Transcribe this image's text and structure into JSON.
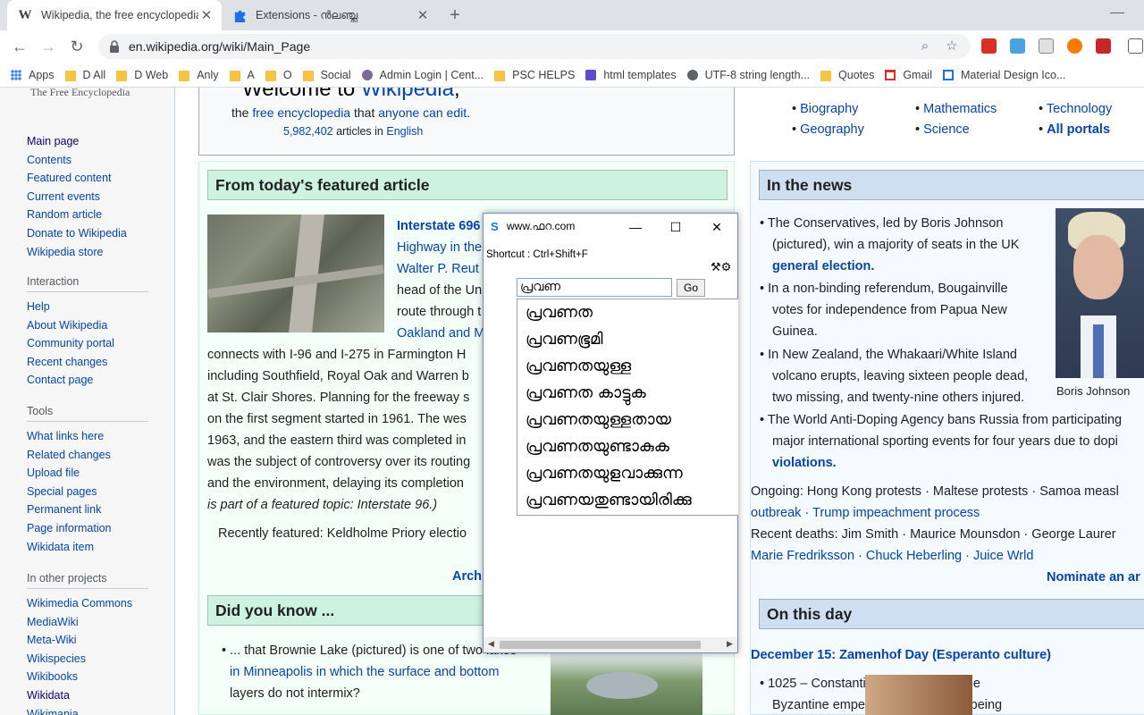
{
  "tabs": [
    {
      "title": "Wikipedia, the free encyclopedia",
      "favicon": "wikipedia-w-icon"
    },
    {
      "title": "Extensions - ന്‍ലഞ്ച്ല",
      "favicon": "puzzle-icon"
    }
  ],
  "address_bar": {
    "url": "en.wikipedia.org/wiki/Main_Page"
  },
  "bookmarks": [
    "Apps",
    "D All",
    "D Web",
    "Anly",
    "A",
    "O",
    "Social",
    "Admin Login | Cent...",
    "PSC HELPS",
    "html templates",
    "UTF-8 string length...",
    "Quotes",
    "Gmail",
    "Material Design Ico..."
  ],
  "sidebar": {
    "logo_subtitle": "The Free Encyclopedia",
    "navigation": [
      "Main page",
      "Contents",
      "Featured content",
      "Current events",
      "Random article",
      "Donate to Wikipedia",
      "Wikipedia store"
    ],
    "interaction_title": "Interaction",
    "interaction": [
      "Help",
      "About Wikipedia",
      "Community portal",
      "Recent changes",
      "Contact page"
    ],
    "tools_title": "Tools",
    "tools": [
      "What links here",
      "Related changes",
      "Upload file",
      "Special pages",
      "Permanent link",
      "Page information",
      "Wikidata item"
    ],
    "other_title": "In other projects",
    "other": [
      "Wikimedia Commons",
      "MediaWiki",
      "Meta-Wiki",
      "Wikispecies",
      "Wikibooks",
      "Wikidata",
      "Wikimania"
    ]
  },
  "welcome": {
    "heading_pre": "Welcome to ",
    "heading_link": "Wikipedia",
    "heading_post": ",",
    "sub_pre": "the ",
    "sub_link1": "free encyclopedia",
    "sub_mid": " that ",
    "sub_link2": "anyone can edit",
    "sub_post": ".",
    "count": "5,982,402",
    "count_mid": " articles in ",
    "count_lang": "English"
  },
  "portals": {
    "col1": [
      "Biography",
      "Geography"
    ],
    "col2": [
      "Mathematics",
      "Science"
    ],
    "col3": [
      "Technology",
      "All portals"
    ]
  },
  "featured": {
    "heading": "From today's featured article",
    "lines": [
      "Interstate 696",
      "Highway in the",
      "Walter P. Reut",
      "head of the Un",
      "route through t",
      "Oakland and M",
      "connects with I-96 and I-275 in Farmington H",
      "including Southfield, Royal Oak and Warren b",
      "at St. Clair Shores. Planning for the freeway s",
      "on the first segment started in 1961. The wes",
      "1963, and the eastern third was completed in",
      "was the subject of controversy over its routing",
      "and the environment, delaying its completion",
      "is part of a featured topic: Interstate 96.)"
    ],
    "recently": "Recently featured: Keldholme Priory electio",
    "archive": "Arch"
  },
  "dyk": {
    "heading": "Did you know ...",
    "lines": [
      "• ... that Brownie Lake (pictured) is one of two lakes",
      "in Minneapolis in which the surface and bottom",
      "layers do not intermix?"
    ]
  },
  "news": {
    "heading": "In the news",
    "lines": [
      "• The Conservatives, led by Boris Johnson",
      "(pictured), win a majority of seats in the UK",
      "general election.",
      "• In a non-binding referendum, Bougainville",
      "votes for independence from Papua New",
      "Guinea.",
      "• In New Zealand, the Whakaari/White Island",
      "volcano erupts, leaving sixteen people dead,",
      "two missing, and twenty-nine others injured.",
      "• The World Anti-Doping Agency bans Russia from participating",
      "major international sporting events for four years due to dopi",
      "violations."
    ],
    "caption": "Boris Johnson",
    "ongoing": "Ongoing: Hong Kong protests · Maltese protests · Samoa measl",
    "ongoing2": "outbreak · Trump impeachment process",
    "deaths": "Recent deaths: Jim Smith · Maurice Mounsdon · George Laurer",
    "deaths2": "Marie Fredriksson · Chuck Heberling · Juice Wrld",
    "nominate": "Nominate an ar"
  },
  "otd": {
    "heading": "On this day",
    "date_line": "December 15: Zamenhof Day (Esperanto culture)",
    "line1": "• 1025 – Constantine VIII became sole",
    "line2": "Byzantine emperor, 63 years after being"
  },
  "popup": {
    "title": "www.ഫറ.com",
    "shortcut": "Shortcut : Ctrl+Shift+F",
    "tools": "⚒⚙",
    "input_value": "പ്രവണ",
    "go": "Go",
    "suggestions": [
      "പ്രവണത",
      "പ്രവണഭൂമി",
      "പ്രവണതയുള്ള",
      "പ്രവണത കാട്ടുക",
      "പ്രവണതയുള്ളതായ",
      "പ്രവണതയുണ്ടാകുക",
      "പ്രവണതയുളവാക്കുന്ന",
      "പ്രവണയതുണ്ടായിരിക്കു"
    ]
  }
}
